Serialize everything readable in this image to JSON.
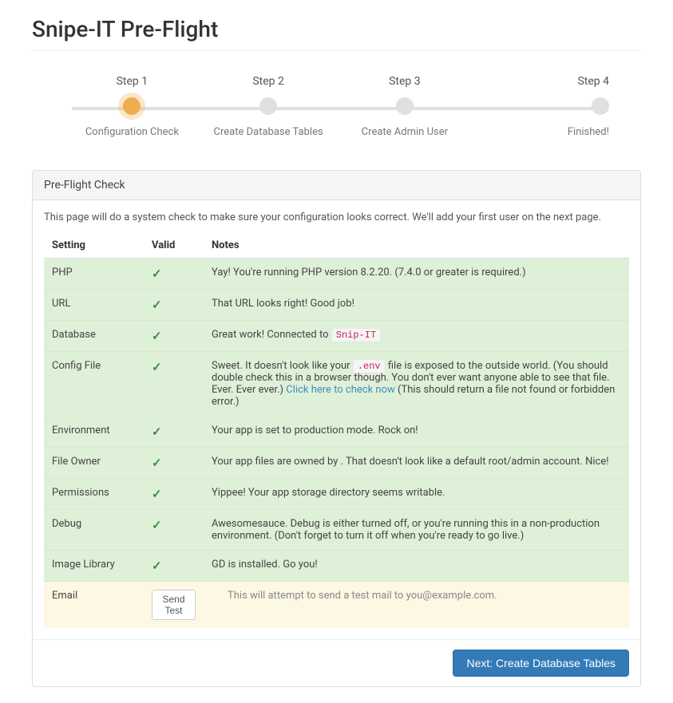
{
  "title": "Snipe-IT Pre-Flight",
  "steps": [
    {
      "top": "Step 1",
      "bottom": "Configuration Check",
      "active": true
    },
    {
      "top": "Step 2",
      "bottom": "Create Database Tables",
      "active": false
    },
    {
      "top": "Step 3",
      "bottom": "Create Admin User",
      "active": false
    },
    {
      "top": "Step 4",
      "bottom": "Finished!",
      "active": false
    }
  ],
  "panel_title": "Pre-Flight Check",
  "intro": "This page will do a system check to make sure your configuration looks correct. We'll add your first user on the next page.",
  "columns": {
    "setting": "Setting",
    "valid": "Valid",
    "notes": "Notes"
  },
  "rows": {
    "php": {
      "setting": "PHP",
      "notes": "Yay! You're running PHP version 8.2.20. (7.4.0 or greater is required.)"
    },
    "url": {
      "setting": "URL",
      "notes": "That URL looks right! Good job!"
    },
    "database": {
      "setting": "Database",
      "notes_pre": "Great work! Connected to ",
      "code": "Snip-IT"
    },
    "config": {
      "setting": "Config File",
      "notes_pre": "Sweet. It doesn't look like your ",
      "code": ".env",
      "notes_mid": " file is exposed to the outside world. (You should double check this in a browser though. You don't ever want anyone able to see that file. Ever. Ever ever.) ",
      "link": "Click here to check now",
      "notes_post": " (This should return a file not found or forbidden error.)"
    },
    "environment": {
      "setting": "Environment",
      "notes": "Your app is set to production mode. Rock on!"
    },
    "fileowner": {
      "setting": "File Owner",
      "notes_pre": "Your app files are owned by ",
      "notes_post": " . That doesn't look like a default root/admin account. Nice!"
    },
    "permissions": {
      "setting": "Permissions",
      "notes": "Yippee! Your app storage directory seems writable."
    },
    "debug": {
      "setting": "Debug",
      "notes": "Awesomesauce. Debug is either turned off, or you're running this in a non-production environment. (Don't forget to turn it off when you're ready to go live.)"
    },
    "image": {
      "setting": "Image Library",
      "notes": "GD is installed. Go you!"
    },
    "email": {
      "setting": "Email",
      "button": "Send Test",
      "notes": "This will attempt to send a test mail to you@example.com."
    }
  },
  "next_button": "Next: Create Database Tables"
}
